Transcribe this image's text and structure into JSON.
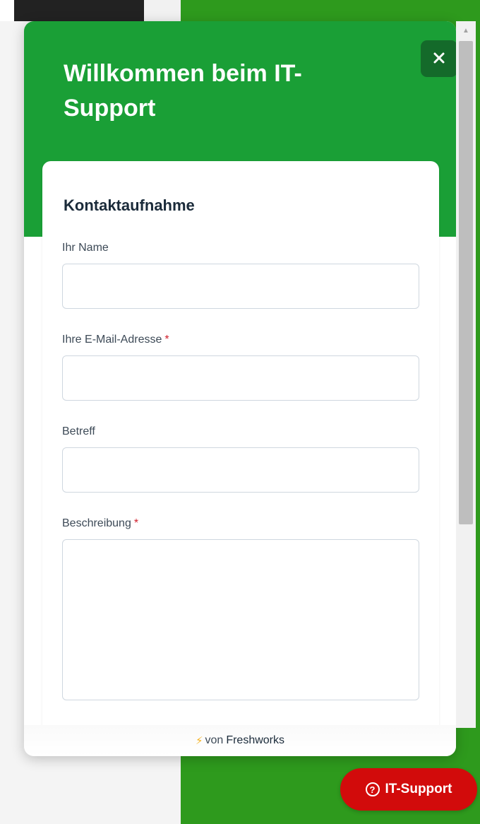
{
  "widget": {
    "title": "Willkommen beim IT-Support",
    "close_icon": "close-icon",
    "header_color": "#1a9f36",
    "form": {
      "section_title": "Kontaktaufnahme",
      "fields": [
        {
          "label": "Ihr Name",
          "required": false,
          "value": "",
          "type": "text"
        },
        {
          "label": "Ihre E-Mail-Adresse",
          "required": true,
          "value": "",
          "type": "text"
        },
        {
          "label": "Betreff",
          "required": false,
          "value": "",
          "type": "text"
        },
        {
          "label": "Beschreibung",
          "required": true,
          "value": "",
          "type": "textarea"
        }
      ],
      "required_marker": "*"
    },
    "footer": {
      "prefix": "von",
      "brand": "Freshworks",
      "icon": "lightning-bolt-icon"
    }
  },
  "launcher": {
    "label": "IT-Support",
    "icon": "question-circle-icon",
    "color": "#d20b0b"
  },
  "colors": {
    "page_green": "#2e9a1d",
    "required": "#d0202d"
  }
}
